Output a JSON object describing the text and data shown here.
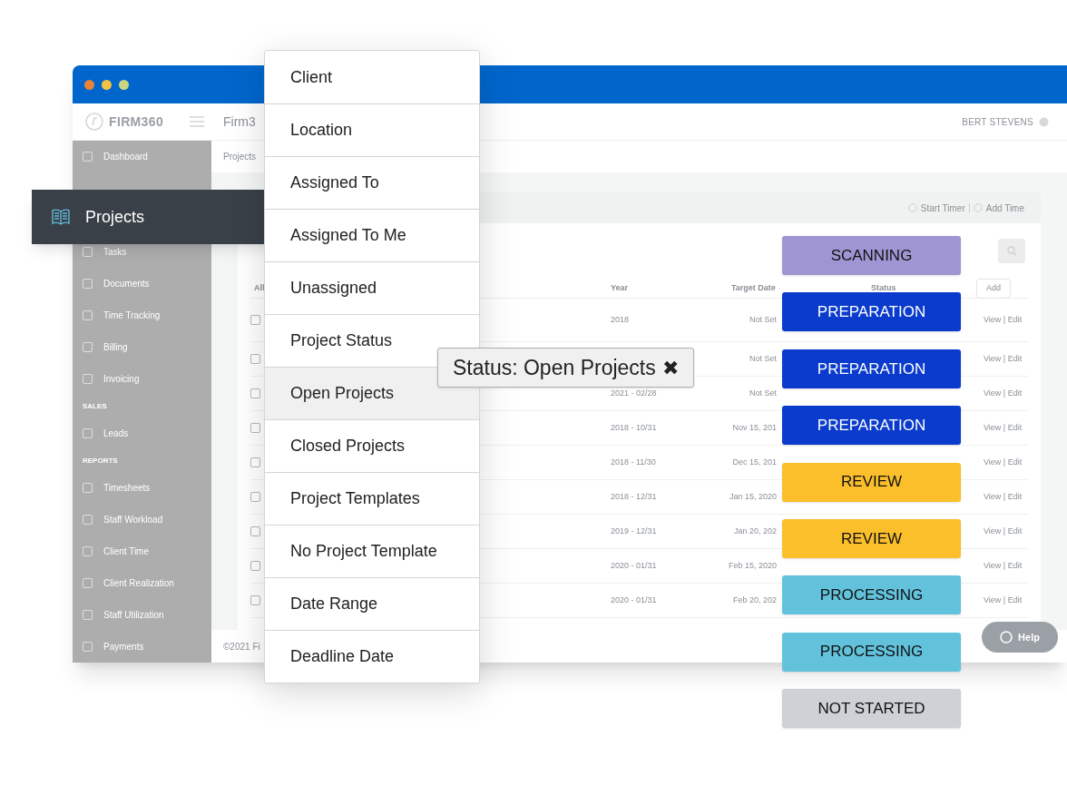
{
  "app": {
    "logo": "FIRM360",
    "header_title": "Firm3",
    "user": "BERT STEVENS",
    "breadcrumb": "Projects",
    "toolbar": [
      "Start Timer",
      "Add Time"
    ],
    "add_button": "Add",
    "footer": "©2021 Fi",
    "help_button": "Help"
  },
  "sidebar": {
    "items_above": [
      {
        "kind": "item",
        "label": "Dashboard"
      }
    ],
    "items_below": [
      {
        "kind": "item",
        "label": "Tasks"
      },
      {
        "kind": "item",
        "label": "Documents"
      },
      {
        "kind": "item",
        "label": "Time Tracking"
      },
      {
        "kind": "item",
        "label": "Billing"
      },
      {
        "kind": "item",
        "label": "Invoicing"
      },
      {
        "kind": "section",
        "label": "SALES"
      },
      {
        "kind": "item",
        "label": "Leads"
      },
      {
        "kind": "section",
        "label": "REPORTS"
      },
      {
        "kind": "item",
        "label": "Timesheets"
      },
      {
        "kind": "item",
        "label": "Staff Workload"
      },
      {
        "kind": "item",
        "label": "Client Time"
      },
      {
        "kind": "item",
        "label": "Client Realization"
      },
      {
        "kind": "item",
        "label": "Staff Utilization"
      },
      {
        "kind": "item",
        "label": "Payments"
      }
    ]
  },
  "table": {
    "columns": [
      "All",
      "Year",
      "Target Date",
      "Status"
    ],
    "rows": [
      {
        "checked": false,
        "year": "2018",
        "target_date": "Not Set",
        "actions": "View | Edit"
      },
      {
        "checked": false,
        "year": "",
        "target_date": "Not Set",
        "actions": "View | Edit"
      },
      {
        "checked": false,
        "year": "2021 - 02/28",
        "target_date": "Not Set",
        "actions": "View | Edit"
      },
      {
        "checked": false,
        "year": "2018 - 10/31",
        "target_date": "Nov 15, 201",
        "actions": "View | Edit"
      },
      {
        "checked": false,
        "year": "2018 - 11/30",
        "target_date": "Dec 15, 201",
        "actions": "View | Edit"
      },
      {
        "checked": false,
        "year": "2018 - 12/31",
        "target_date": "Jan 15, 2020",
        "actions": "View | Edit"
      },
      {
        "checked": false,
        "year": "2019 - 12/31",
        "target_date": "Jan 20, 202",
        "actions": "View | Edit"
      },
      {
        "checked": false,
        "year": "2020 - 01/31",
        "target_date": "Feb 15, 2020",
        "actions": "View | Edit"
      },
      {
        "checked": false,
        "year": "2020 - 01/31",
        "target_date": "Feb 20, 202",
        "actions": "View | Edit"
      }
    ]
  },
  "highlight": {
    "label": "Projects"
  },
  "filter_menu": [
    {
      "label": "Client",
      "selected": false
    },
    {
      "label": "Location",
      "selected": false
    },
    {
      "label": "Assigned To",
      "selected": false
    },
    {
      "label": "Assigned To Me",
      "selected": false
    },
    {
      "label": "Unassigned",
      "selected": false
    },
    {
      "label": "Project Status",
      "selected": false
    },
    {
      "label": "Open Projects",
      "selected": true
    },
    {
      "label": "Closed Projects",
      "selected": false
    },
    {
      "label": "Project Templates",
      "selected": false
    },
    {
      "label": "No Project Template",
      "selected": false
    },
    {
      "label": "Date Range",
      "selected": false
    },
    {
      "label": "Deadline Date",
      "selected": false
    }
  ],
  "filter_chip": {
    "label": "Status: Open Projects",
    "close": "✖"
  },
  "status_badges": [
    {
      "label": "SCANNING",
      "color": "#a095d3"
    },
    {
      "label": "PREPARATION",
      "color": "#0a3bcc"
    },
    {
      "label": "PREPARATION",
      "color": "#0a3bcc"
    },
    {
      "label": "PREPARATION",
      "color": "#0a3bcc"
    },
    {
      "label": "REVIEW",
      "color": "#fbbf2c"
    },
    {
      "label": "REVIEW",
      "color": "#fbbf2c"
    },
    {
      "label": "PROCESSING",
      "color": "#62c2dc"
    },
    {
      "label": "PROCESSING",
      "color": "#62c2dc"
    },
    {
      "label": "NOT STARTED",
      "color": "#ced1d5"
    }
  ]
}
